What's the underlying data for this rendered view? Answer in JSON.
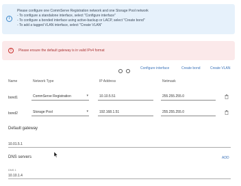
{
  "info": {
    "lines": [
      "Please configure one CommServe Registration network and one Storage Pool network",
      "- To configure a standalone interface, select \"Configure interface\"",
      "- To configure a bonded interface using active-backup or LACP, select \"Create bond\"",
      "- To add a tagged VLAN interface, select \"Create VLAN\""
    ]
  },
  "warning": {
    "text": "Please ensure the default gateway is in valid IPv4 format"
  },
  "actions": {
    "configure_interface": "Configure interface",
    "create_bond": "Create bond",
    "create_vlan": "Create VLAN"
  },
  "table": {
    "headers": {
      "name": "Name",
      "network_type": "Network Type",
      "ip_address": "IP Address",
      "netmask": "Netmask"
    },
    "rows": [
      {
        "name": "bond1",
        "network_type": "CommServe Registration",
        "ip_address": "10.10.5.51",
        "netmask": "255.255.255.0"
      },
      {
        "name": "bond2",
        "network_type": "Storage Pool",
        "ip_address": "192.168.1.51",
        "netmask": "255.255.255.0"
      }
    ]
  },
  "gateway": {
    "label": "Default gateway",
    "value": "10.01.5.1"
  },
  "dns": {
    "label": "DNS servers",
    "add_label": "ADD",
    "field_label": "DNS 1",
    "value": "10.10.1.4"
  },
  "colors": {
    "info_bg": "#e6f1fb",
    "warning_bg": "#fbe9ea",
    "link": "#3b73b9"
  }
}
